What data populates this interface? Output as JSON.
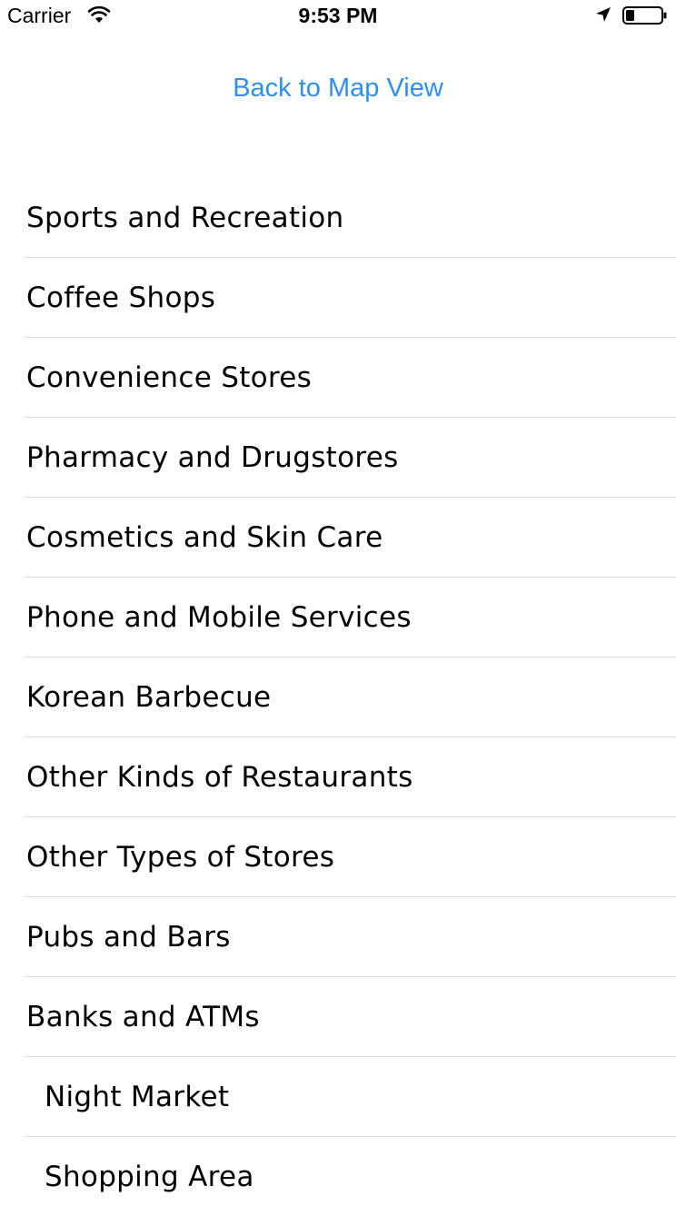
{
  "status_bar": {
    "carrier": "Carrier",
    "time": "9:53 PM",
    "icons": [
      "wifi-icon",
      "location-arrow-icon",
      "battery-icon"
    ]
  },
  "header": {
    "back_link": "Back to Map View",
    "accent_color": "#2d8ff0"
  },
  "categories": [
    {
      "label": "Sports and Recreation"
    },
    {
      "label": "Coffee Shops"
    },
    {
      "label": "Convenience Stores"
    },
    {
      "label": "Pharmacy and Drugstores"
    },
    {
      "label": "Cosmetics and Skin Care"
    },
    {
      "label": "Phone and Mobile Services"
    },
    {
      "label": "Korean Barbecue"
    },
    {
      "label": "Other Kinds of Restaurants"
    },
    {
      "label": "Other Types of Stores"
    },
    {
      "label": "Pubs and Bars"
    },
    {
      "label": "Banks and ATMs"
    },
    {
      "label": "Night Market"
    },
    {
      "label": "Shopping Area"
    }
  ]
}
